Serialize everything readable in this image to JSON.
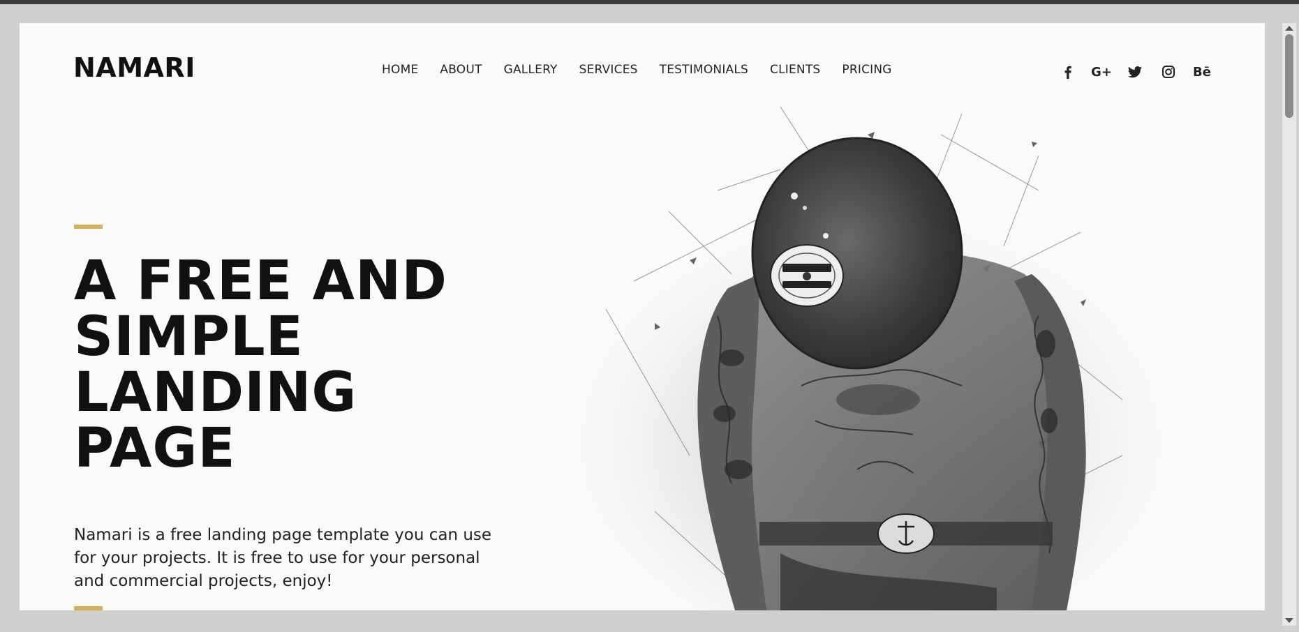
{
  "site": {
    "logo": "NAMARI"
  },
  "nav": {
    "items": [
      {
        "label": "HOME"
      },
      {
        "label": "ABOUT"
      },
      {
        "label": "GALLERY"
      },
      {
        "label": "SERVICES"
      },
      {
        "label": "TESTIMONIALS"
      },
      {
        "label": "CLIENTS"
      },
      {
        "label": "PRICING"
      }
    ]
  },
  "social": {
    "icons": [
      "facebook-icon",
      "google-plus-icon",
      "twitter-icon",
      "instagram-icon",
      "behance-icon"
    ],
    "behance_text": "Bē",
    "google_text": "G+"
  },
  "hero": {
    "title_lines": [
      "A FREE AND",
      "SIMPLE",
      "LANDING",
      "PAGE"
    ],
    "description": "Namari is a free landing page template you can use for your projects. It is free to use for your personal and commercial projects, enjoy!",
    "illustration": "tattooed-figure-sketch-illustration"
  },
  "colors": {
    "accent": "#d4b257",
    "text": "#111111",
    "background": "#fafafa"
  }
}
